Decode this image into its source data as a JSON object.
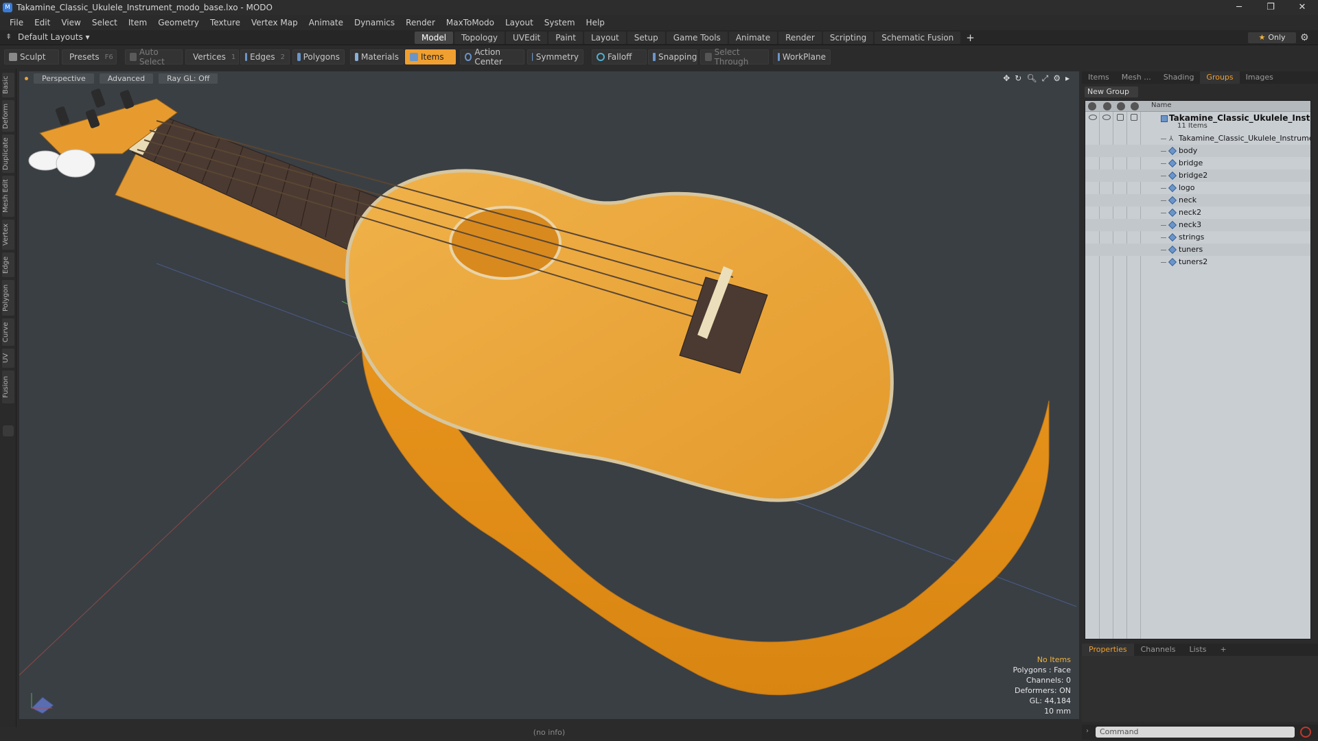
{
  "window": {
    "title": "Takamine_Classic_Ukulele_Instrument_modo_base.lxo - MODO",
    "min_icon": "minimize-icon",
    "max_icon": "restore-icon",
    "close_icon": "close-icon"
  },
  "menu": [
    "File",
    "Edit",
    "View",
    "Select",
    "Item",
    "Geometry",
    "Texture",
    "Vertex Map",
    "Animate",
    "Dynamics",
    "Render",
    "MaxToModo",
    "Layout",
    "System",
    "Help"
  ],
  "layout_bar": {
    "layout_label": "Default Layouts ▾",
    "tabs": [
      "Model",
      "Topology",
      "UVEdit",
      "Paint",
      "Layout",
      "Setup",
      "Game Tools",
      "Animate",
      "Render",
      "Scripting",
      "Schematic Fusion"
    ],
    "active_tab": "Model",
    "only_label": "Only"
  },
  "toolbar": {
    "sculpt": "Sculpt",
    "presets": "Presets",
    "presets_key": "F6",
    "auto_select": "Auto Select",
    "vertices": "Vertices",
    "vertices_key": "1",
    "edges": "Edges",
    "edges_key": "2",
    "polygons": "Polygons",
    "materials": "Materials",
    "items": "Items",
    "action_center": "Action Center",
    "symmetry": "Symmetry",
    "falloff": "Falloff",
    "snapping": "Snapping",
    "select_through": "Select Through",
    "workplane": "WorkPlane"
  },
  "left_strip": [
    "Basic",
    "Deform",
    "Duplicate",
    "Mesh Edit",
    "Vertex",
    "Edge",
    "Polygon",
    "Curve",
    "UV",
    "Fusion"
  ],
  "viewport": {
    "view_mode": "Perspective",
    "advanced": "Advanced",
    "raygl": "Ray GL: Off",
    "stats": {
      "no_items": "No Items",
      "polygons": "Polygons : Face",
      "channels": "Channels: 0",
      "deformers": "Deformers: ON",
      "gl": "GL: 44,184",
      "scale": "10 mm"
    }
  },
  "right_panel": {
    "tabs": [
      "Items",
      "Mesh ...",
      "Shading",
      "Groups",
      "Images"
    ],
    "active_tab": "Groups",
    "new_group": "New Group",
    "column_name": "Name",
    "group_name": "Takamine_Classic_Ukulele_Inst ...",
    "group_count": "11 Items",
    "items": [
      "Takamine_Classic_Ukulele_Instrument",
      "body",
      "bridge",
      "bridge2",
      "logo",
      "neck",
      "neck2",
      "neck3",
      "strings",
      "tuners",
      "tuners2"
    ]
  },
  "properties": {
    "tabs": [
      "Properties",
      "Channels",
      "Lists"
    ],
    "active_tab": "Properties",
    "command_placeholder": "Command"
  },
  "status": "(no info)",
  "colors": {
    "accent": "#f0a030",
    "viewport_bg": "#3a3f44",
    "ukulele_body": "#e8a23a",
    "fretboard": "#4a3a32"
  }
}
